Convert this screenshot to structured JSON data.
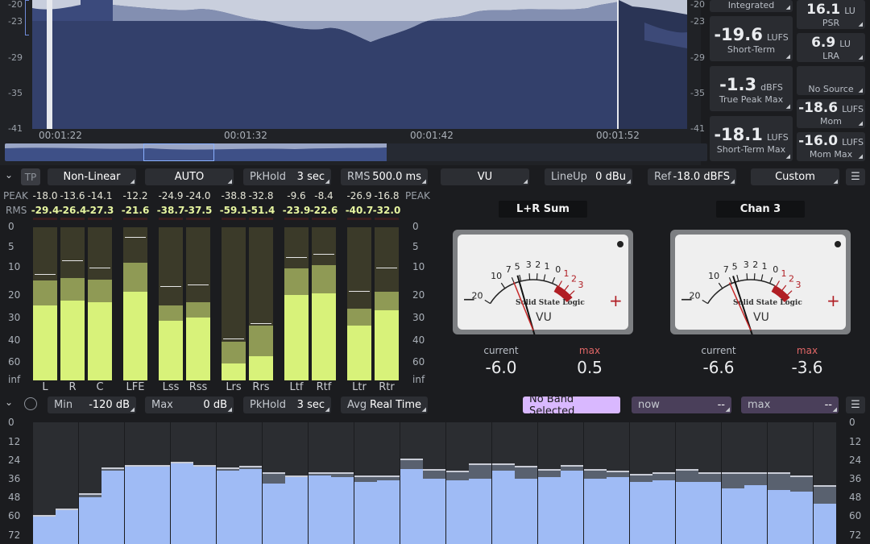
{
  "history": {
    "y_ticks": [
      "-20",
      "-23",
      "-29",
      "-35",
      "-41"
    ],
    "y_ticks_right": [
      "-20",
      "-23",
      "-29",
      "-35",
      "-41"
    ],
    "time_labels": [
      "00:01:22",
      "00:01:32",
      "00:01:42",
      "00:01:52"
    ]
  },
  "stats": {
    "integrated_caption": "Integrated",
    "short_term": {
      "value": "-19.6",
      "unit": "LUFS",
      "caption": "Short-Term"
    },
    "true_peak_max": {
      "value": "-1.3",
      "unit": "dBFS",
      "caption": "True Peak Max"
    },
    "short_term_max": {
      "value": "-18.1",
      "unit": "LUFS",
      "caption": "Short-Term Max"
    },
    "psr": {
      "value": "16.1",
      "unit": "LU",
      "caption": "PSR"
    },
    "lra": {
      "value": "6.9",
      "unit": "LU",
      "caption": "LRA"
    },
    "no_source": "No Source",
    "mom": {
      "value": "-18.6",
      "unit": "LUFS",
      "caption": "Mom"
    },
    "mom_max": {
      "value": "-16.0",
      "unit": "LUFS",
      "caption": "Mom Max"
    }
  },
  "meter_controls": {
    "tp": "TP",
    "scale": "Non-Linear",
    "mode": "AUTO",
    "pkhold_label": "PkHold",
    "pkhold_value": "3 sec",
    "rms_label": "RMS",
    "rms_value": "500.0 ms"
  },
  "vu_controls": {
    "type": "VU",
    "lineup_label": "LineUp",
    "lineup_value": "0 dBu",
    "ref_label": "Ref",
    "ref_value": "-18.0 dBFS",
    "preset": "Custom"
  },
  "meters": {
    "row_peak_label": "PEAK",
    "row_rms_label": "RMS",
    "scale": [
      "0",
      "5",
      "10",
      "20",
      "30",
      "40",
      "60",
      "inf"
    ],
    "channels": [
      {
        "name": "L",
        "peak": "-18.0",
        "rms": "-29.4",
        "lvl_rms": 0.49,
        "lvl_peak": 0.65,
        "hold": 0.69
      },
      {
        "name": "R",
        "peak": "-13.6",
        "rms": "-26.4",
        "lvl_rms": 0.52,
        "lvl_peak": 0.67,
        "hold": 0.78
      },
      {
        "name": "C",
        "peak": "-14.1",
        "rms": "-27.3",
        "lvl_rms": 0.51,
        "lvl_peak": 0.66,
        "hold": 0.73
      },
      {
        "name": "LFE",
        "peak": "-12.2",
        "rms": "-21.6",
        "lvl_rms": 0.58,
        "lvl_peak": 0.77,
        "hold": 0.93
      },
      {
        "name": "Lss",
        "peak": "-24.9",
        "rms": "-38.7",
        "lvl_rms": 0.39,
        "lvl_peak": 0.49,
        "hold": 0.61
      },
      {
        "name": "Rss",
        "peak": "-24.0",
        "rms": "-37.5",
        "lvl_rms": 0.41,
        "lvl_peak": 0.51,
        "hold": 0.62
      },
      {
        "name": "Lrs",
        "peak": "-38.8",
        "rms": "-59.1",
        "lvl_rms": 0.11,
        "lvl_peak": 0.25,
        "hold": 0.27
      },
      {
        "name": "Rrs",
        "peak": "-32.8",
        "rms": "-51.4",
        "lvl_rms": 0.16,
        "lvl_peak": 0.36,
        "hold": 0.37
      },
      {
        "name": "Ltf",
        "peak": "-9.6",
        "rms": "-23.9",
        "lvl_rms": 0.56,
        "lvl_peak": 0.73,
        "hold": 0.8
      },
      {
        "name": "Rtf",
        "peak": "-8.4",
        "rms": "-22.6",
        "lvl_rms": 0.57,
        "lvl_peak": 0.75,
        "hold": 0.82
      },
      {
        "name": "Ltr",
        "peak": "-26.9",
        "rms": "-40.7",
        "lvl_rms": 0.36,
        "lvl_peak": 0.47,
        "hold": 0.58
      },
      {
        "name": "Rtr",
        "peak": "-16.8",
        "rms": "-32.0",
        "lvl_rms": 0.46,
        "lvl_peak": 0.58,
        "hold": 0.73
      }
    ]
  },
  "vu": [
    {
      "title": "L+R Sum",
      "current_label": "current",
      "max_label": "max",
      "current": "-6.0",
      "max": "0.5",
      "brand": "Solid State Logic",
      "vu_text": "VU"
    },
    {
      "title": "Chan 3",
      "current_label": "current",
      "max_label": "max",
      "current": "-6.6",
      "max": "-3.6",
      "brand": "Solid State Logic",
      "vu_text": "VU"
    }
  ],
  "vu_scale": {
    "numbers": [
      "20",
      "10",
      "7",
      "5",
      "3",
      "2",
      "1",
      "0",
      "1",
      "2",
      "3"
    ],
    "minus": "−",
    "plus": "+"
  },
  "spectrum_controls": {
    "min_label": "Min",
    "min_value": "-120 dB",
    "max_label": "Max",
    "max_value": "0 dB",
    "pkhold_label": "PkHold",
    "pkhold_value": "3 sec",
    "avg_label": "Avg",
    "avg_value": "Real Time",
    "band_status": "No Band Selected",
    "now_label": "now",
    "now_value": "--",
    "max2_label": "max",
    "max2_value": "--"
  },
  "spectrum": {
    "scale": [
      "0",
      "12",
      "24",
      "36",
      "48",
      "60",
      "72"
    ],
    "bars_db": [
      59,
      55,
      48,
      31,
      27,
      27,
      26,
      28,
      31,
      30,
      39,
      35,
      34,
      35,
      38,
      37,
      30,
      36,
      37,
      36,
      31,
      36,
      35,
      31,
      36,
      35,
      38,
      37,
      38,
      38,
      42,
      40,
      43,
      44,
      52
    ],
    "peak_db": [
      59,
      55,
      45,
      29,
      27,
      27,
      25,
      27,
      29,
      28,
      32,
      34,
      32,
      32,
      34,
      34,
      23,
      30,
      31,
      26,
      26,
      28,
      30,
      27,
      30,
      31,
      33,
      32,
      30,
      32,
      32,
      32,
      32,
      34,
      40
    ]
  },
  "colors": {
    "rms": "#d8f27a",
    "peak": "#8f9a55",
    "meter_bg": "#3b3a29",
    "spectrum": "#9fbbf5",
    "spectrum_peak": "#59616f",
    "band_status": "#d9b8ff"
  }
}
